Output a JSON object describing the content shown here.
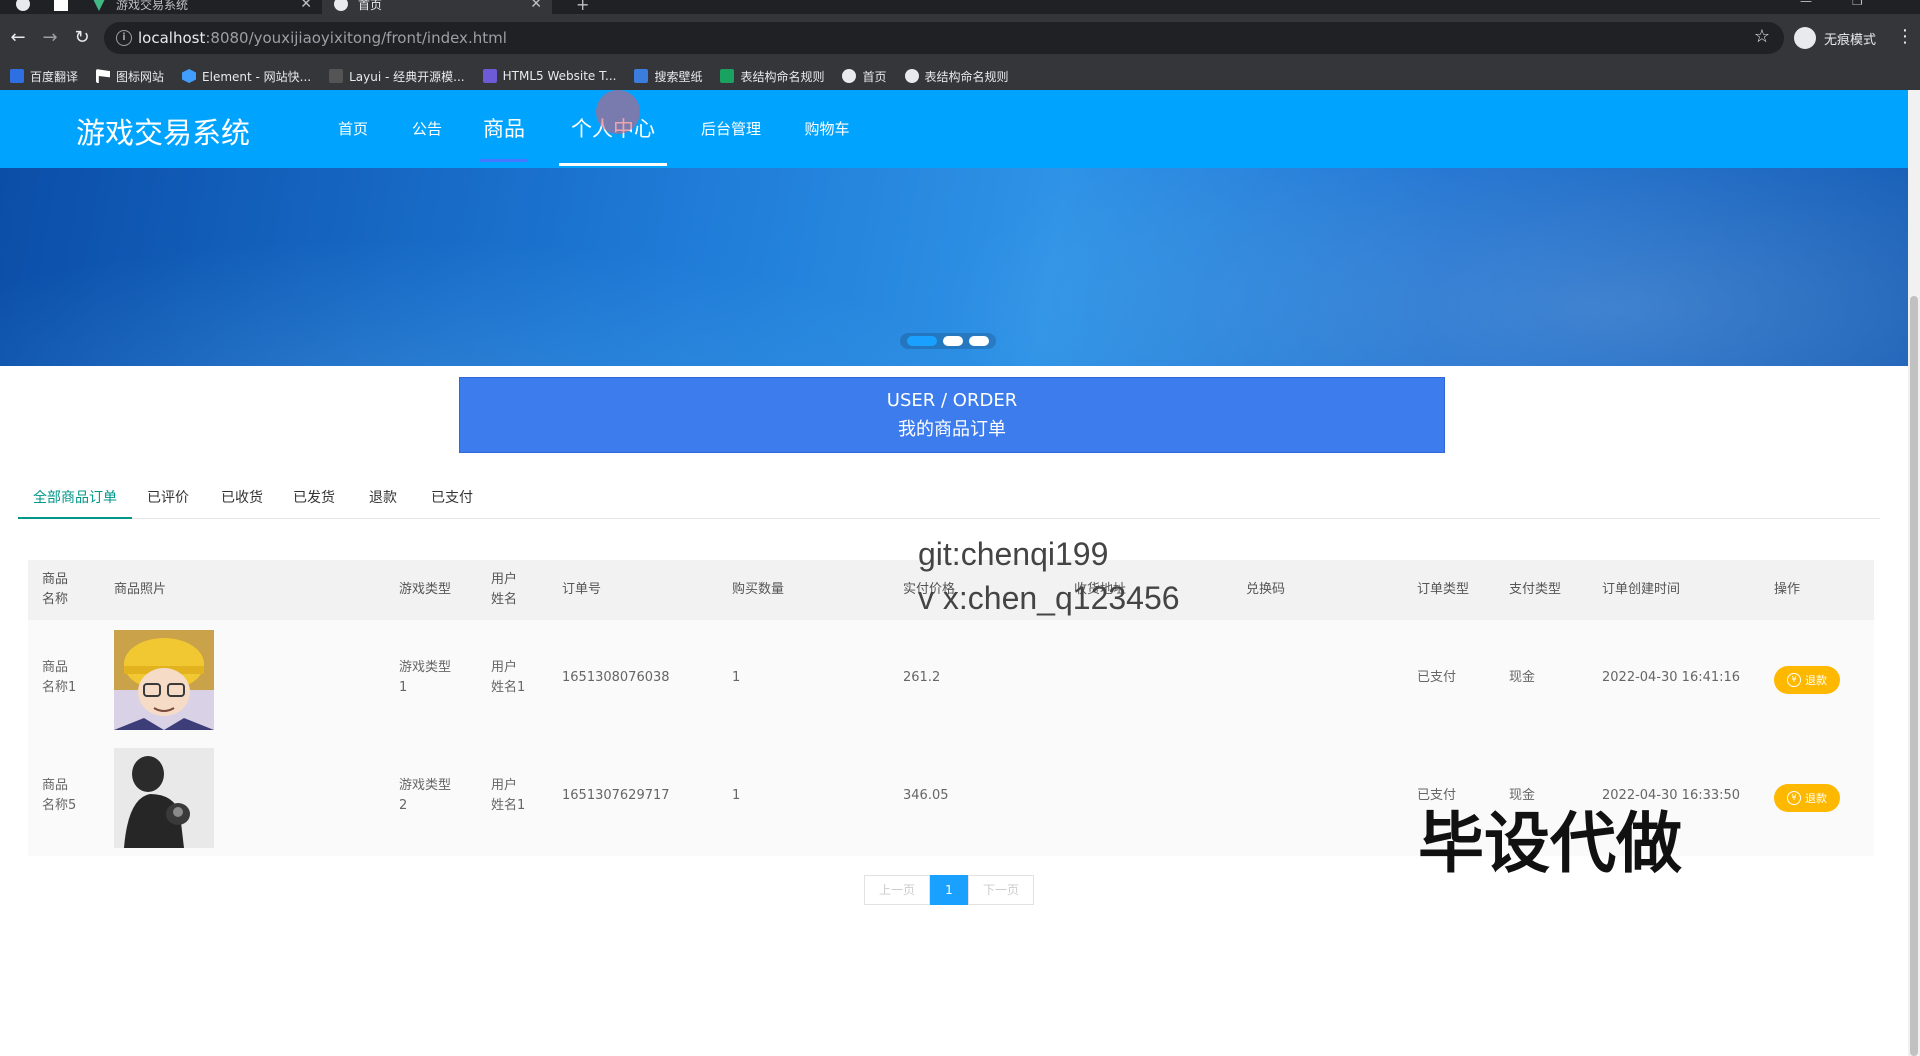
{
  "browser": {
    "tabs": [
      {
        "title": "游戏交易系统",
        "active": false
      },
      {
        "title": "首页",
        "active": true
      }
    ],
    "url_host": "localhost",
    "url_rest": ":8080/youxijiaoyixitong/front/index.html",
    "profile_label": "无痕模式",
    "bookmarks": [
      {
        "label": "百度翻译",
        "color": "#2f6fe4"
      },
      {
        "label": "图标网站",
        "color": "#ffffff"
      },
      {
        "label": "Element - 网站快...",
        "color": "#409eff"
      },
      {
        "label": "Layui - 经典开源模...",
        "color": "#2f2f2f"
      },
      {
        "label": "HTML5 Website T...",
        "color": "#6b5bd6"
      },
      {
        "label": "搜索壁纸",
        "color": "#3b7ddd"
      },
      {
        "label": "表结构命名规则",
        "color": "#1aa260"
      },
      {
        "label": "首页",
        "color": "#e8eaed"
      },
      {
        "label": "表结构命名规则",
        "color": "#e8eaed"
      }
    ]
  },
  "site": {
    "brand": "游戏交易系统",
    "nav": [
      {
        "label": "首页"
      },
      {
        "label": "公告"
      },
      {
        "label": "商品"
      },
      {
        "label": "个人中心"
      },
      {
        "label": "后台管理"
      },
      {
        "label": "购物车"
      }
    ],
    "banner_slides": 3,
    "banner_active_index": 0
  },
  "section": {
    "title_en": "USER / ORDER",
    "title_cn": "我的商品订单"
  },
  "order_tabs": [
    {
      "label": "全部商品订单",
      "active": true
    },
    {
      "label": "已评价",
      "active": false
    },
    {
      "label": "已收货",
      "active": false
    },
    {
      "label": "已发货",
      "active": false
    },
    {
      "label": "退款",
      "active": false
    },
    {
      "label": "已支付",
      "active": false
    }
  ],
  "table": {
    "headers": {
      "name_1": "商品",
      "name_2": "名称",
      "photo": "商品照片",
      "game_type": "游戏类型",
      "user_1": "用户",
      "user_2": "姓名",
      "order_no": "订单号",
      "qty": "购买数量",
      "price": "实付价格",
      "address": "收货地址",
      "code": "兑换码",
      "order_type": "订单类型",
      "pay_type": "支付类型",
      "created": "订单创建时间",
      "action": "操作"
    },
    "rows": [
      {
        "name_1": "商品",
        "name_2": "名称1",
        "game_type_1": "游戏类型",
        "game_type_2": "1",
        "user_1": "用户",
        "user_2": "姓名1",
        "order_no": "1651308076038",
        "qty": "1",
        "price": "261.2",
        "address": "",
        "code": "",
        "order_type": "已支付",
        "pay_type": "现金",
        "created": "2022-04-30 16:41:16",
        "action": "退款",
        "photo_icon": "cartoon-boy-yellow-hat"
      },
      {
        "name_1": "商品",
        "name_2": "名称5",
        "game_type_1": "游戏类型",
        "game_type_2": "2",
        "user_1": "用户",
        "user_2": "姓名1",
        "order_no": "1651307629717",
        "qty": "1",
        "price": "346.05",
        "address": "",
        "code": "",
        "order_type": "已支付",
        "pay_type": "现金",
        "created": "2022-04-30 16:33:50",
        "action": "退款",
        "photo_icon": "silhouette-man"
      }
    ]
  },
  "pagination": {
    "prev": "上一页",
    "current": "1",
    "next": "下一页"
  },
  "watermarks": {
    "git": "git:chenqi199",
    "wx": "v x:chen_q123456",
    "ad": "毕设代做"
  },
  "colors": {
    "nav_bg": "#00a4ff",
    "title_box": "#3d7cec",
    "tab_active": "#009688",
    "refund_btn": "#ffb800",
    "pager_active": "#1aa0ff"
  }
}
